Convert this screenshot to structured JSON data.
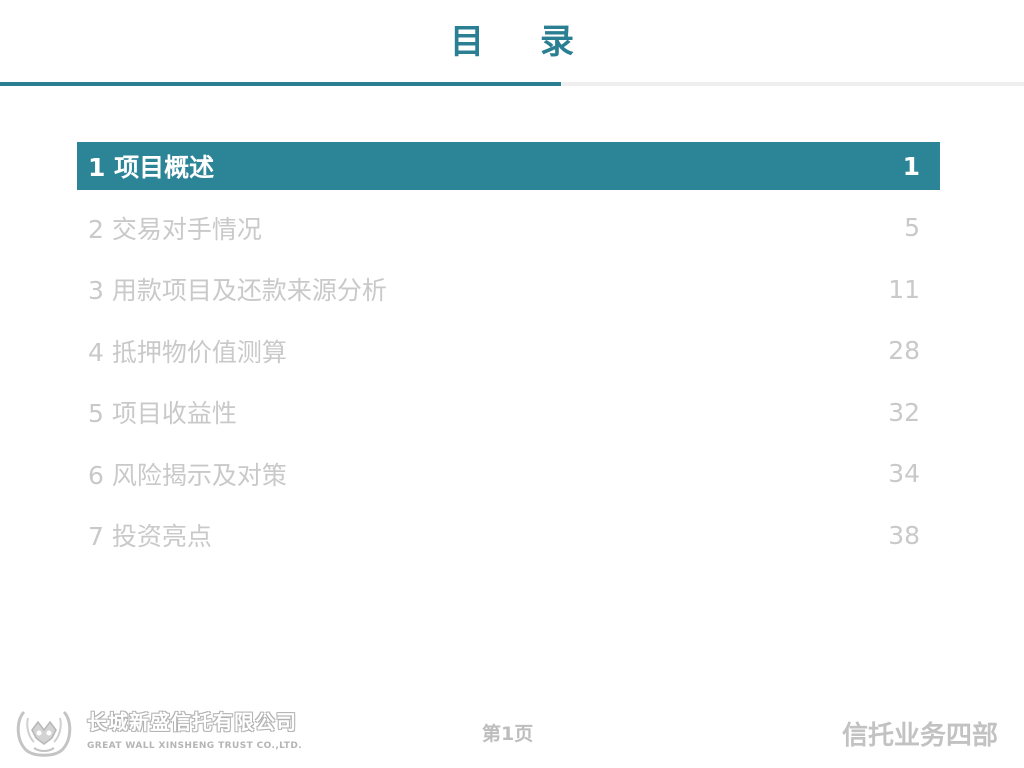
{
  "header": {
    "title": "目录"
  },
  "toc": {
    "items": [
      {
        "label": "1 项目概述",
        "page": "1"
      },
      {
        "label": "2 交易对手情况",
        "page": "5"
      },
      {
        "label": "3 用款项目及还款来源分析",
        "page": "11"
      },
      {
        "label": "4 抵押物价值测算",
        "page": "28"
      },
      {
        "label": "5 项目收益性",
        "page": "32"
      },
      {
        "label": "6 风险揭示及对策",
        "page": "34"
      },
      {
        "label": "7 投资亮点",
        "page": "38"
      }
    ]
  },
  "footer": {
    "company_cn": "长城新盛信托有限公司",
    "company_en": "GREAT WALL XINSHENG TRUST CO.,LTD.",
    "page_label": "第1页",
    "department": "信托业务四部"
  },
  "colors": {
    "accent": "#2b7f93",
    "inactive_text": "#c9c9c9"
  }
}
